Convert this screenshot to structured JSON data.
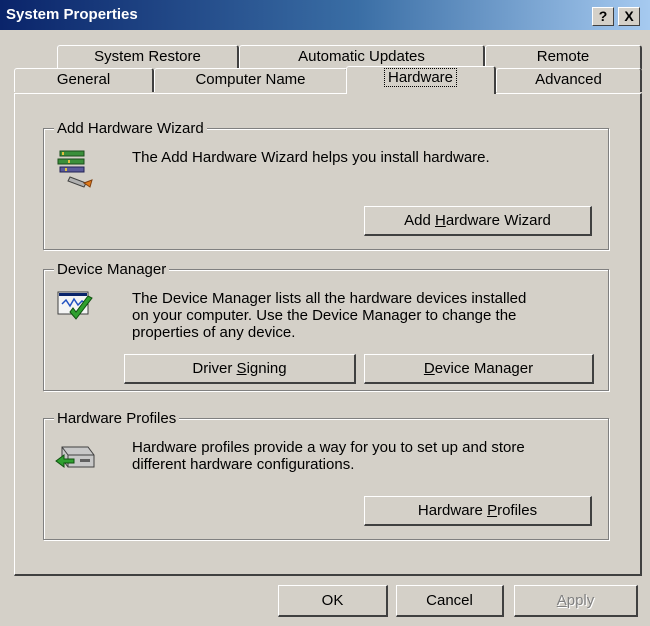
{
  "window": {
    "title": "System Properties",
    "help_label": "?",
    "close_label": "X"
  },
  "tabs_row_back": [
    {
      "label": "System Restore"
    },
    {
      "label": "Automatic Updates"
    },
    {
      "label": "Remote"
    }
  ],
  "tabs_row_front": [
    {
      "label": "General"
    },
    {
      "label": "Computer Name"
    },
    {
      "label": "Hardware"
    },
    {
      "label": "Advanced"
    }
  ],
  "active_tab": "Hardware",
  "groups": {
    "add_hardware": {
      "title": "Add Hardware Wizard",
      "description": "The Add Hardware Wizard helps you install hardware.",
      "icon": "add-hardware-wizard-icon",
      "button": {
        "pre": "Add ",
        "accel": "H",
        "post": "ardware Wizard"
      }
    },
    "device_manager": {
      "title": "Device Manager",
      "description_lines": [
        "The Device Manager lists all the hardware devices installed",
        "on your computer. Use the Device Manager to change the",
        "properties of any device."
      ],
      "icon": "device-manager-icon",
      "driver_button": {
        "pre": "Driver ",
        "accel": "S",
        "post": "igning"
      },
      "device_button": {
        "pre": "",
        "accel": "D",
        "post": "evice Manager"
      }
    },
    "hardware_profiles": {
      "title": "Hardware Profiles",
      "description_lines": [
        "Hardware profiles provide a way for you to set up and store",
        "different hardware configurations."
      ],
      "icon": "hardware-profiles-icon",
      "button": {
        "pre": "Hardware ",
        "accel": "P",
        "post": "rofiles"
      }
    }
  },
  "footer": {
    "ok_label": "OK",
    "cancel_label": "Cancel",
    "apply": {
      "pre": "",
      "accel": "A",
      "post": "pply"
    }
  }
}
